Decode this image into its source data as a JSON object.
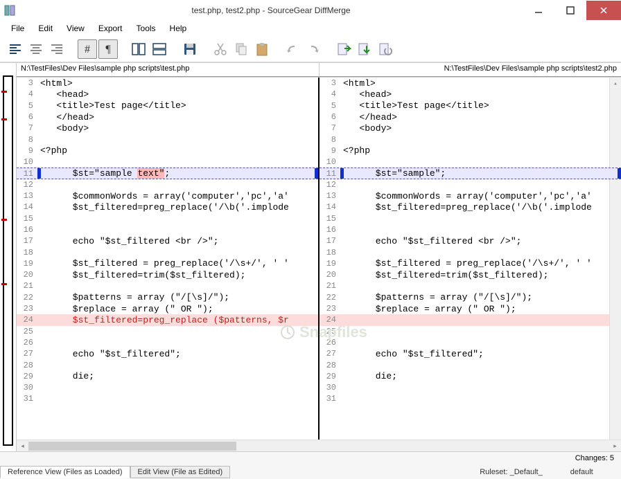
{
  "window": {
    "title": "test.php, test2.php - SourceGear DiffMerge"
  },
  "menu": [
    "File",
    "Edit",
    "View",
    "Export",
    "Tools",
    "Help"
  ],
  "toolbar": {
    "groups": [
      [
        "align-left",
        "align-center",
        "align-right"
      ],
      [
        "hash",
        "pilcrow"
      ],
      [
        "split-v",
        "split-h"
      ],
      [
        "save"
      ],
      [
        "cut",
        "copy",
        "paste"
      ],
      [
        "undo",
        "redo"
      ],
      [
        "doc-next",
        "doc-next2",
        "doc-refresh"
      ]
    ]
  },
  "panes": {
    "left_path": "N:\\TestFiles\\Dev Files\\sample php scripts\\test.php",
    "right_path": "N:\\TestFiles\\Dev Files\\sample php scripts\\test2.php",
    "left_lines": [
      {
        "n": 3,
        "t": "<html>"
      },
      {
        "n": 4,
        "t": "   <head>"
      },
      {
        "n": 5,
        "t": "   <title>Test page</title>"
      },
      {
        "n": 6,
        "t": "   </head>"
      },
      {
        "n": 7,
        "t": "   <body>"
      },
      {
        "n": 8,
        "t": ""
      },
      {
        "n": 9,
        "t": "<?php"
      },
      {
        "n": 10,
        "t": ""
      },
      {
        "n": 11,
        "t": "      $st=\"sample text\";",
        "diff": "change",
        "hl_start": 18,
        "hl_end": 23
      },
      {
        "n": 12,
        "t": ""
      },
      {
        "n": 13,
        "t": "      $commonWords = array('computer','pc','a'"
      },
      {
        "n": 14,
        "t": "      $st_filtered=preg_replace('/\\b('.implode"
      },
      {
        "n": 15,
        "t": ""
      },
      {
        "n": 16,
        "t": ""
      },
      {
        "n": 17,
        "t": "      echo \"$st_filtered <br />\";"
      },
      {
        "n": 18,
        "t": ""
      },
      {
        "n": 19,
        "t": "      $st_filtered = preg_replace('/\\s+/', ' '"
      },
      {
        "n": 20,
        "t": "      $st_filtered=trim($st_filtered);"
      },
      {
        "n": 21,
        "t": ""
      },
      {
        "n": 22,
        "t": "      $patterns = array (\"/[\\s]/\");"
      },
      {
        "n": 23,
        "t": "      $replace = array (\" OR \");"
      },
      {
        "n": 24,
        "t": "      $st_filtered=preg_replace ($patterns, $r",
        "diff": "del"
      },
      {
        "n": 25,
        "t": ""
      },
      {
        "n": 26,
        "t": ""
      },
      {
        "n": 27,
        "t": "      echo \"$st_filtered\";"
      },
      {
        "n": 28,
        "t": ""
      },
      {
        "n": 29,
        "t": "      die;"
      },
      {
        "n": 30,
        "t": ""
      },
      {
        "n": 31,
        "t": ""
      }
    ],
    "right_lines": [
      {
        "n": 3,
        "t": "<html>"
      },
      {
        "n": 4,
        "t": "   <head>"
      },
      {
        "n": 5,
        "t": "   <title>Test page</title>"
      },
      {
        "n": 6,
        "t": "   </head>"
      },
      {
        "n": 7,
        "t": "   <body>"
      },
      {
        "n": 8,
        "t": ""
      },
      {
        "n": 9,
        "t": "<?php"
      },
      {
        "n": 10,
        "t": ""
      },
      {
        "n": 11,
        "t": "      $st=\"sample\";",
        "diff": "change"
      },
      {
        "n": 12,
        "t": ""
      },
      {
        "n": 13,
        "t": "      $commonWords = array('computer','pc','a'"
      },
      {
        "n": 14,
        "t": "      $st_filtered=preg_replace('/\\b('.implode"
      },
      {
        "n": 15,
        "t": ""
      },
      {
        "n": 16,
        "t": ""
      },
      {
        "n": 17,
        "t": "      echo \"$st_filtered <br />\";"
      },
      {
        "n": 18,
        "t": ""
      },
      {
        "n": 19,
        "t": "      $st_filtered = preg_replace('/\\s+/', ' '"
      },
      {
        "n": 20,
        "t": "      $st_filtered=trim($st_filtered);"
      },
      {
        "n": 21,
        "t": ""
      },
      {
        "n": 22,
        "t": "      $patterns = array (\"/[\\s]/\");"
      },
      {
        "n": 23,
        "t": "      $replace = array (\" OR \");"
      },
      {
        "n": 24,
        "t": "",
        "diff": "del"
      },
      {
        "n": 25,
        "t": ""
      },
      {
        "n": 26,
        "t": ""
      },
      {
        "n": 27,
        "t": "      echo \"$st_filtered\";"
      },
      {
        "n": 28,
        "t": ""
      },
      {
        "n": 29,
        "t": "      die;"
      },
      {
        "n": 30,
        "t": ""
      },
      {
        "n": 31,
        "t": ""
      }
    ]
  },
  "gutter_marks": [
    0.04,
    0.16,
    0.4,
    0.55
  ],
  "status": {
    "changes": "Changes: 5",
    "tab_ref": "Reference View (Files as Loaded)",
    "tab_edit": "Edit View (File as Edited)",
    "ruleset_label": "Ruleset:",
    "ruleset_value": "_Default_",
    "encoding": "default"
  },
  "watermark": "Snapfiles"
}
